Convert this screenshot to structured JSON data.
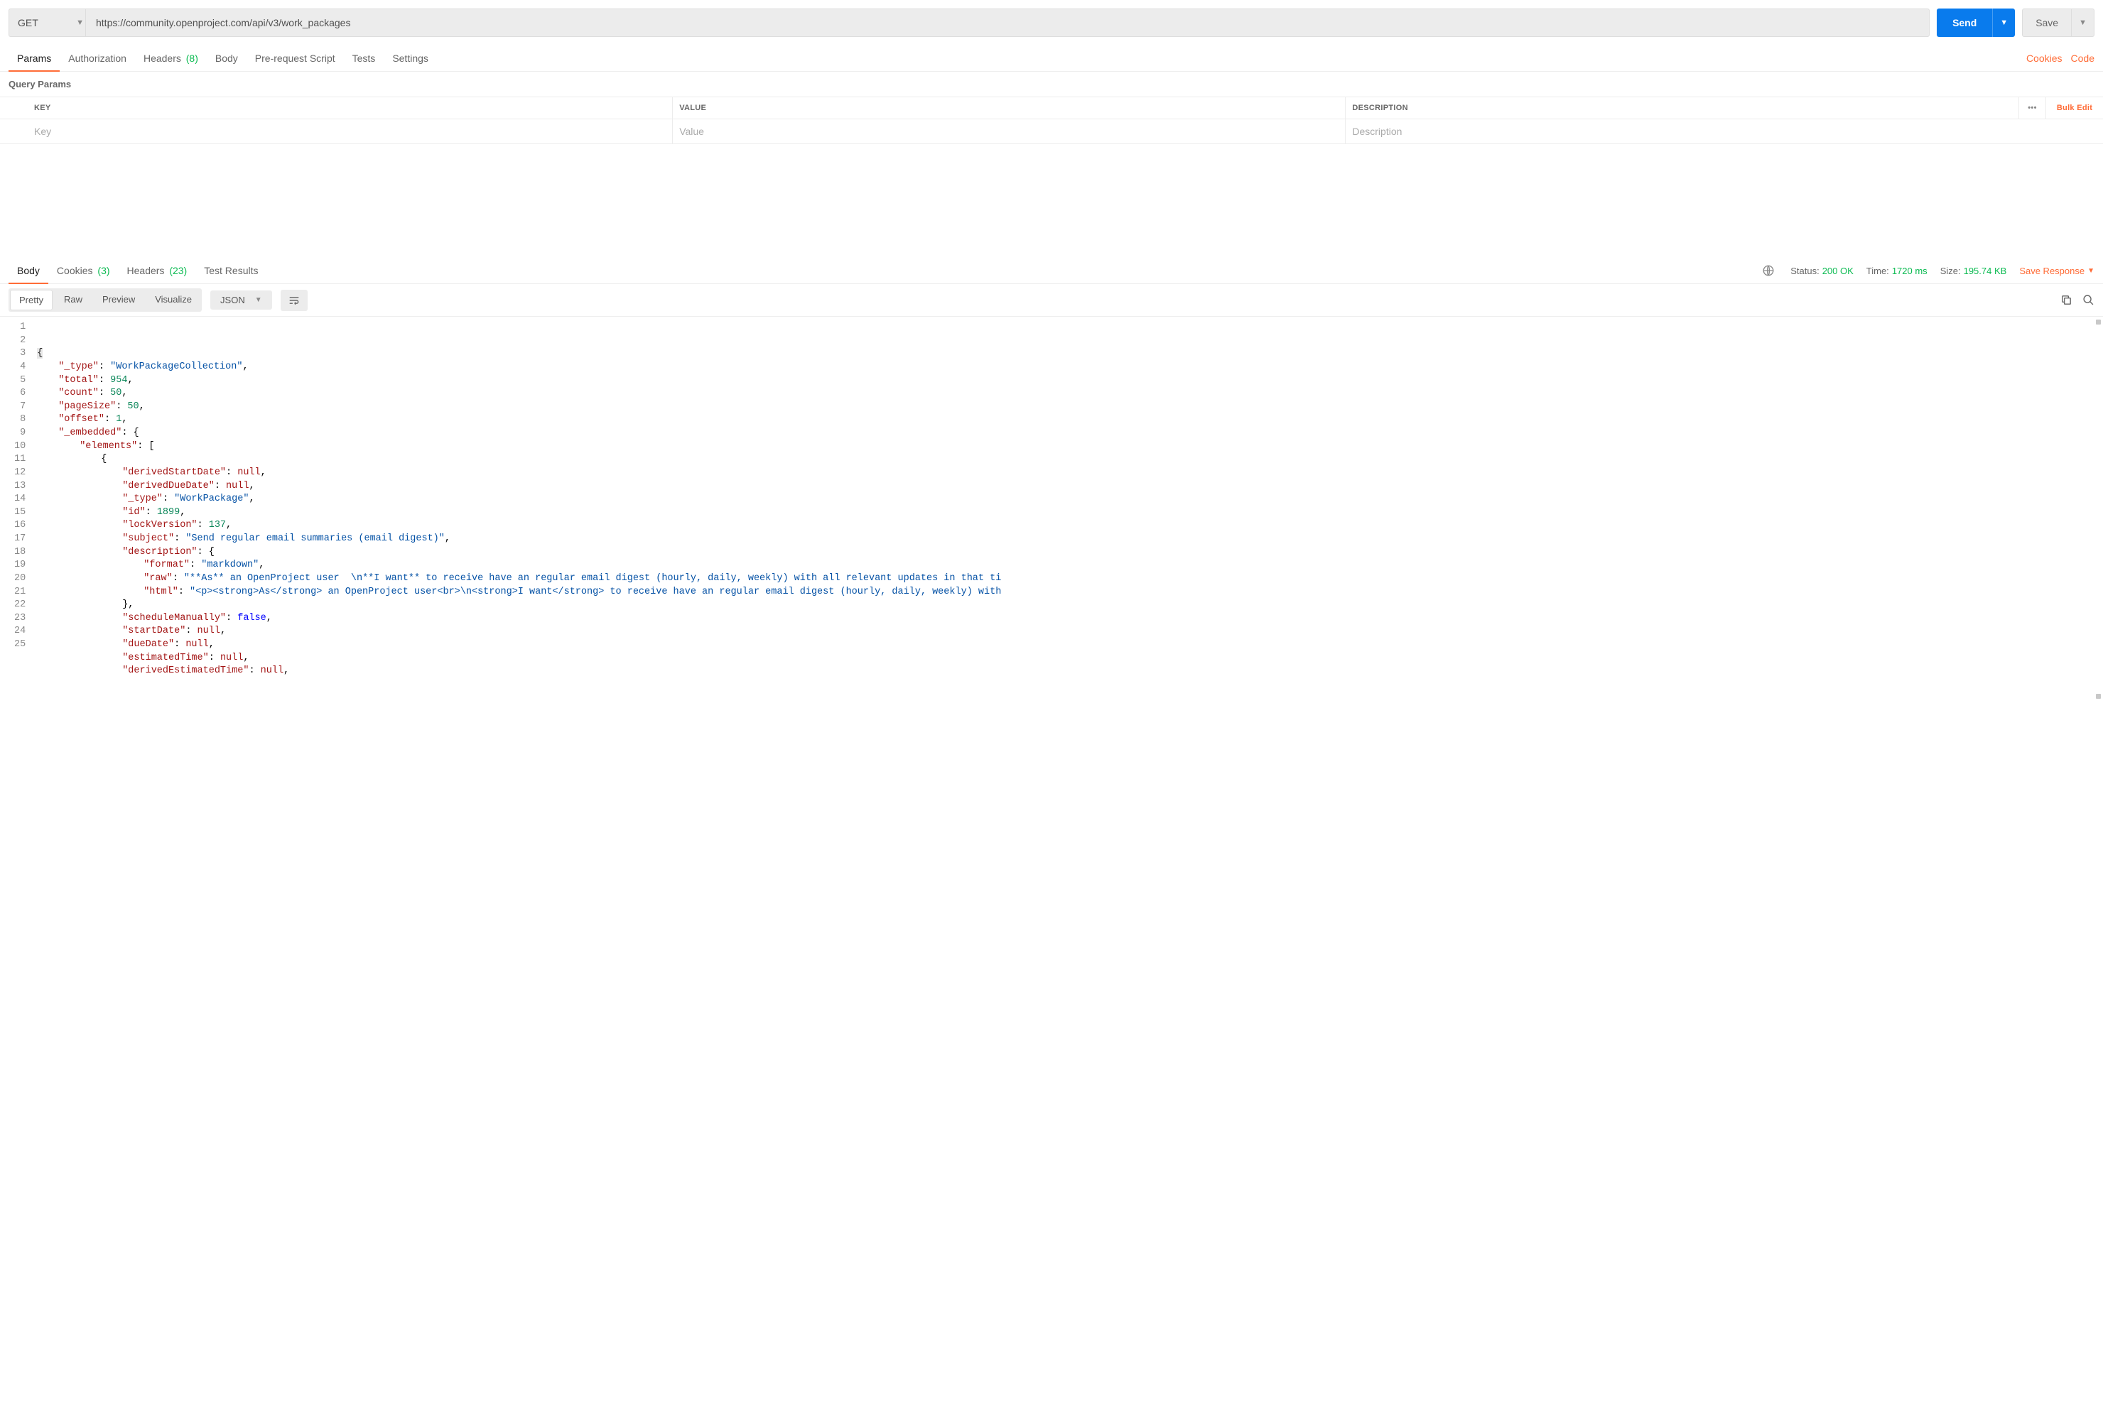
{
  "request": {
    "method": "GET",
    "url": "https://community.openproject.com/api/v3/work_packages",
    "send_label": "Send",
    "save_label": "Save"
  },
  "request_tabs": [
    {
      "label": "Params",
      "active": true
    },
    {
      "label": "Authorization"
    },
    {
      "label": "Headers",
      "count": "(8)"
    },
    {
      "label": "Body"
    },
    {
      "label": "Pre-request Script"
    },
    {
      "label": "Tests"
    },
    {
      "label": "Settings"
    }
  ],
  "request_tabs_right": {
    "cookies": "Cookies",
    "code": "Code"
  },
  "query_params_label": "Query Params",
  "params_headers": {
    "key": "KEY",
    "value": "VALUE",
    "description": "DESCRIPTION",
    "bulk": "Bulk Edit"
  },
  "params_placeholders": {
    "key": "Key",
    "value": "Value",
    "description": "Description"
  },
  "response_tabs": [
    {
      "label": "Body",
      "active": true
    },
    {
      "label": "Cookies",
      "count": "(3)"
    },
    {
      "label": "Headers",
      "count": "(23)"
    },
    {
      "label": "Test Results"
    }
  ],
  "status": {
    "status_label": "Status:",
    "status_value": "200 OK",
    "time_label": "Time:",
    "time_value": "1720 ms",
    "size_label": "Size:",
    "size_value": "195.74 KB",
    "save_response": "Save Response"
  },
  "body_modes": [
    "Pretty",
    "Raw",
    "Preview",
    "Visualize"
  ],
  "body_format": "JSON",
  "code_lines": [
    {
      "n": 1,
      "indent": 0,
      "tokens": [
        {
          "t": "hl",
          "v": "{"
        }
      ]
    },
    {
      "n": 2,
      "indent": 1,
      "tokens": [
        {
          "t": "key",
          "v": "\"_type\""
        },
        {
          "t": "punc",
          "v": ": "
        },
        {
          "t": "str",
          "v": "\"WorkPackageCollection\""
        },
        {
          "t": "punc",
          "v": ","
        }
      ]
    },
    {
      "n": 3,
      "indent": 1,
      "tokens": [
        {
          "t": "key",
          "v": "\"total\""
        },
        {
          "t": "punc",
          "v": ": "
        },
        {
          "t": "num",
          "v": "954"
        },
        {
          "t": "punc",
          "v": ","
        }
      ]
    },
    {
      "n": 4,
      "indent": 1,
      "tokens": [
        {
          "t": "key",
          "v": "\"count\""
        },
        {
          "t": "punc",
          "v": ": "
        },
        {
          "t": "num",
          "v": "50"
        },
        {
          "t": "punc",
          "v": ","
        }
      ]
    },
    {
      "n": 5,
      "indent": 1,
      "tokens": [
        {
          "t": "key",
          "v": "\"pageSize\""
        },
        {
          "t": "punc",
          "v": ": "
        },
        {
          "t": "num",
          "v": "50"
        },
        {
          "t": "punc",
          "v": ","
        }
      ]
    },
    {
      "n": 6,
      "indent": 1,
      "tokens": [
        {
          "t": "key",
          "v": "\"offset\""
        },
        {
          "t": "punc",
          "v": ": "
        },
        {
          "t": "num",
          "v": "1"
        },
        {
          "t": "punc",
          "v": ","
        }
      ]
    },
    {
      "n": 7,
      "indent": 1,
      "tokens": [
        {
          "t": "key",
          "v": "\"_embedded\""
        },
        {
          "t": "punc",
          "v": ": {"
        }
      ]
    },
    {
      "n": 8,
      "indent": 2,
      "tokens": [
        {
          "t": "key",
          "v": "\"elements\""
        },
        {
          "t": "punc",
          "v": ": ["
        }
      ]
    },
    {
      "n": 9,
      "indent": 3,
      "tokens": [
        {
          "t": "punc",
          "v": "{"
        }
      ]
    },
    {
      "n": 10,
      "indent": 4,
      "tokens": [
        {
          "t": "key",
          "v": "\"derivedStartDate\""
        },
        {
          "t": "punc",
          "v": ": "
        },
        {
          "t": "null",
          "v": "null"
        },
        {
          "t": "punc",
          "v": ","
        }
      ]
    },
    {
      "n": 11,
      "indent": 4,
      "tokens": [
        {
          "t": "key",
          "v": "\"derivedDueDate\""
        },
        {
          "t": "punc",
          "v": ": "
        },
        {
          "t": "null",
          "v": "null"
        },
        {
          "t": "punc",
          "v": ","
        }
      ]
    },
    {
      "n": 12,
      "indent": 4,
      "tokens": [
        {
          "t": "key",
          "v": "\"_type\""
        },
        {
          "t": "punc",
          "v": ": "
        },
        {
          "t": "str",
          "v": "\"WorkPackage\""
        },
        {
          "t": "punc",
          "v": ","
        }
      ]
    },
    {
      "n": 13,
      "indent": 4,
      "tokens": [
        {
          "t": "key",
          "v": "\"id\""
        },
        {
          "t": "punc",
          "v": ": "
        },
        {
          "t": "num",
          "v": "1899"
        },
        {
          "t": "punc",
          "v": ","
        }
      ]
    },
    {
      "n": 14,
      "indent": 4,
      "tokens": [
        {
          "t": "key",
          "v": "\"lockVersion\""
        },
        {
          "t": "punc",
          "v": ": "
        },
        {
          "t": "num",
          "v": "137"
        },
        {
          "t": "punc",
          "v": ","
        }
      ]
    },
    {
      "n": 15,
      "indent": 4,
      "tokens": [
        {
          "t": "key",
          "v": "\"subject\""
        },
        {
          "t": "punc",
          "v": ": "
        },
        {
          "t": "str",
          "v": "\"Send regular email summaries (email digest)\""
        },
        {
          "t": "punc",
          "v": ","
        }
      ]
    },
    {
      "n": 16,
      "indent": 4,
      "tokens": [
        {
          "t": "key",
          "v": "\"description\""
        },
        {
          "t": "punc",
          "v": ": {"
        }
      ]
    },
    {
      "n": 17,
      "indent": 5,
      "tokens": [
        {
          "t": "key",
          "v": "\"format\""
        },
        {
          "t": "punc",
          "v": ": "
        },
        {
          "t": "str",
          "v": "\"markdown\""
        },
        {
          "t": "punc",
          "v": ","
        }
      ]
    },
    {
      "n": 18,
      "indent": 5,
      "tokens": [
        {
          "t": "key",
          "v": "\"raw\""
        },
        {
          "t": "punc",
          "v": ": "
        },
        {
          "t": "str",
          "v": "\"**As** an OpenProject user  \\n**I want** to receive have an regular email digest (hourly, daily, weekly) with all relevant updates in that ti"
        }
      ]
    },
    {
      "n": 19,
      "indent": 5,
      "tokens": [
        {
          "t": "key",
          "v": "\"html\""
        },
        {
          "t": "punc",
          "v": ": "
        },
        {
          "t": "str",
          "v": "\"<p><strong>As</strong> an OpenProject user<br>\\n<strong>I want</strong> to receive have an regular email digest (hourly, daily, weekly) with"
        }
      ]
    },
    {
      "n": 20,
      "indent": 4,
      "tokens": [
        {
          "t": "punc",
          "v": "},"
        }
      ]
    },
    {
      "n": 21,
      "indent": 4,
      "tokens": [
        {
          "t": "key",
          "v": "\"scheduleManually\""
        },
        {
          "t": "punc",
          "v": ": "
        },
        {
          "t": "false",
          "v": "false"
        },
        {
          "t": "punc",
          "v": ","
        }
      ]
    },
    {
      "n": 22,
      "indent": 4,
      "tokens": [
        {
          "t": "key",
          "v": "\"startDate\""
        },
        {
          "t": "punc",
          "v": ": "
        },
        {
          "t": "null",
          "v": "null"
        },
        {
          "t": "punc",
          "v": ","
        }
      ]
    },
    {
      "n": 23,
      "indent": 4,
      "tokens": [
        {
          "t": "key",
          "v": "\"dueDate\""
        },
        {
          "t": "punc",
          "v": ": "
        },
        {
          "t": "null",
          "v": "null"
        },
        {
          "t": "punc",
          "v": ","
        }
      ]
    },
    {
      "n": 24,
      "indent": 4,
      "tokens": [
        {
          "t": "key",
          "v": "\"estimatedTime\""
        },
        {
          "t": "punc",
          "v": ": "
        },
        {
          "t": "null",
          "v": "null"
        },
        {
          "t": "punc",
          "v": ","
        }
      ]
    },
    {
      "n": 25,
      "indent": 4,
      "tokens": [
        {
          "t": "key",
          "v": "\"derivedEstimatedTime\""
        },
        {
          "t": "punc",
          "v": ": "
        },
        {
          "t": "null",
          "v": "null"
        },
        {
          "t": "punc",
          "v": ","
        }
      ]
    }
  ]
}
